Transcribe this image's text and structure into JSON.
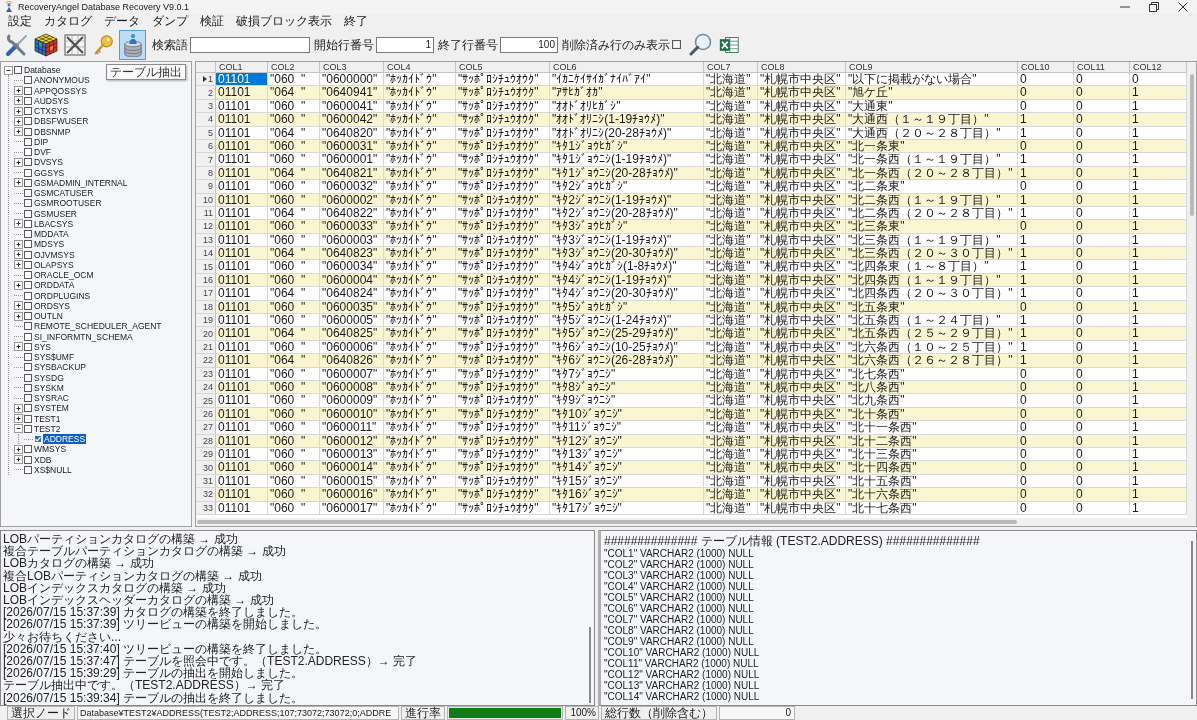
{
  "window": {
    "title": "RecoveryAngel Database Recovery V9.0.1"
  },
  "menu": [
    "設定",
    "カタログ",
    "データ",
    "ダンプ",
    "検証",
    "破損ブロック表示",
    "終了"
  ],
  "toolbar": {
    "buttons": [
      {
        "kind": "tools",
        "highlighted": false
      },
      {
        "kind": "cube",
        "highlighted": false
      },
      {
        "kind": "crossed",
        "highlighted": false
      },
      {
        "kind": "key",
        "highlighted": false
      },
      {
        "kind": "database",
        "highlighted": true,
        "tooltip": "テーブル抽出"
      }
    ],
    "search": {
      "label": "検索語"
    },
    "start_row": {
      "label": "開始行番号",
      "value": "1"
    },
    "end_row": {
      "label": "終了行番号",
      "value": "100"
    },
    "deleted_only": {
      "label": "削除済み行のみ表示",
      "checked": false
    },
    "actions": [
      {
        "kind": "search"
      },
      {
        "kind": "excel"
      }
    ]
  },
  "tree": {
    "nodes": [
      {
        "label": "Database",
        "checked": false,
        "expanded": true,
        "selected": false,
        "children": [
          {
            "label": "ANONYMOUS",
            "checked": false,
            "selected": false
          },
          {
            "label": "APPQOSSYS",
            "checked": false,
            "expanded": false,
            "selected": false
          },
          {
            "label": "AUDSYS",
            "checked": false,
            "expanded": false,
            "selected": false
          },
          {
            "label": "CTXSYS",
            "checked": false,
            "expanded": false,
            "selected": false
          },
          {
            "label": "DBSFWUSER",
            "checked": false,
            "expanded": false,
            "selected": false
          },
          {
            "label": "DBSNMP",
            "checked": false,
            "expanded": false,
            "selected": false
          },
          {
            "label": "DIP",
            "checked": false,
            "selected": false
          },
          {
            "label": "DVF",
            "checked": false,
            "selected": false
          },
          {
            "label": "DVSYS",
            "checked": false,
            "expanded": false,
            "selected": false
          },
          {
            "label": "GGSYS",
            "checked": false,
            "selected": false
          },
          {
            "label": "GSMADMIN_INTERNAL",
            "checked": false,
            "expanded": false,
            "selected": false
          },
          {
            "label": "GSMCATUSER",
            "checked": false,
            "selected": false
          },
          {
            "label": "GSMROOTUSER",
            "checked": false,
            "selected": false
          },
          {
            "label": "GSMUSER",
            "checked": false,
            "selected": false
          },
          {
            "label": "LBACSYS",
            "checked": false,
            "expanded": false,
            "selected": false
          },
          {
            "label": "MDDATA",
            "checked": false,
            "selected": false
          },
          {
            "label": "MDSYS",
            "checked": false,
            "expanded": false,
            "selected": false
          },
          {
            "label": "OJVMSYS",
            "checked": false,
            "expanded": false,
            "selected": false
          },
          {
            "label": "OLAPSYS",
            "checked": false,
            "expanded": false,
            "selected": false
          },
          {
            "label": "ORACLE_OCM",
            "checked": false,
            "selected": false
          },
          {
            "label": "ORDDATA",
            "checked": false,
            "expanded": false,
            "selected": false
          },
          {
            "label": "ORDPLUGINS",
            "checked": false,
            "selected": false
          },
          {
            "label": "ORDSYS",
            "checked": false,
            "expanded": false,
            "selected": false
          },
          {
            "label": "OUTLN",
            "checked": false,
            "expanded": false,
            "selected": false
          },
          {
            "label": "REMOTE_SCHEDULER_AGENT",
            "checked": false,
            "selected": false
          },
          {
            "label": "SI_INFORMTN_SCHEMA",
            "checked": false,
            "selected": false
          },
          {
            "label": "SYS",
            "checked": false,
            "expanded": false,
            "selected": false
          },
          {
            "label": "SYS$UMF",
            "checked": false,
            "selected": false
          },
          {
            "label": "SYSBACKUP",
            "checked": false,
            "selected": false
          },
          {
            "label": "SYSDG",
            "checked": false,
            "selected": false
          },
          {
            "label": "SYSKM",
            "checked": false,
            "selected": false
          },
          {
            "label": "SYSRAC",
            "checked": false,
            "selected": false
          },
          {
            "label": "SYSTEM",
            "checked": false,
            "expanded": false,
            "selected": false
          },
          {
            "label": "TEST1",
            "checked": false,
            "expanded": false,
            "selected": false
          },
          {
            "label": "TEST2",
            "checked": false,
            "expanded": true,
            "selected": false,
            "children": [
              {
                "label": "ADDRESS",
                "checked": true,
                "selected": true
              }
            ]
          },
          {
            "label": "WMSYS",
            "checked": false,
            "expanded": false,
            "selected": false
          },
          {
            "label": "XDB",
            "checked": false,
            "expanded": false,
            "selected": false
          },
          {
            "label": "XS$NULL",
            "checked": false,
            "selected": false
          }
        ]
      }
    ]
  },
  "table": {
    "columns": [
      "COL1",
      "COL2",
      "COL3",
      "COL4",
      "COL5",
      "COL6",
      "COL7",
      "COL8",
      "COL9",
      "COL10",
      "COL11",
      "COL12"
    ],
    "rows": [
      {
        "number": "1",
        "selected": true,
        "cells": [
          "01101",
          "\"060  \"",
          "\"0600000\"",
          "\"ﾎｯｶｲﾄﾞｳ\"",
          "\"ｻｯﾎﾟﾛｼﾁｭｳｵｳｸ\"",
          "\"ｲｶﾆｹｲｻｲｶﾞﾅｲﾊﾞｱｲ\"",
          "\"北海道\"",
          "\"札幌市中央区\"",
          "\"以下に掲載がない場合\"",
          "0",
          "0",
          "0"
        ]
      },
      {
        "number": "2",
        "selected": false,
        "cells": [
          "01101",
          "\"064  \"",
          "\"0640941\"",
          "\"ﾎｯｶｲﾄﾞｳ\"",
          "\"ｻｯﾎﾟﾛｼﾁｭｳｵｳｸ\"",
          "\"ｱｻﾋｶﾞｵｶ\"",
          "\"北海道\"",
          "\"札幌市中央区\"",
          "\"旭ケ丘\"",
          "0",
          "0",
          "1"
        ]
      },
      {
        "number": "3",
        "selected": false,
        "cells": [
          "01101",
          "\"060  \"",
          "\"0600041\"",
          "\"ﾎｯｶｲﾄﾞｳ\"",
          "\"ｻｯﾎﾟﾛｼﾁｭｳｵｳｸ\"",
          "\"ｵｵﾄﾞｵﾘﾋｶﾞｼ\"",
          "\"北海道\"",
          "\"札幌市中央区\"",
          "\"大通東\"",
          "0",
          "0",
          "1"
        ]
      },
      {
        "number": "4",
        "selected": false,
        "cells": [
          "01101",
          "\"060  \"",
          "\"0600042\"",
          "\"ﾎｯｶｲﾄﾞｳ\"",
          "\"ｻｯﾎﾟﾛｼﾁｭｳｵｳｸ\"",
          "\"ｵｵﾄﾞｵﾘﾆｼ(1-19ﾁｮｳﾒ)\"",
          "\"北海道\"",
          "\"札幌市中央区\"",
          "\"大通西（１～１９丁目）\"",
          "1",
          "0",
          "1"
        ]
      },
      {
        "number": "5",
        "selected": false,
        "cells": [
          "01101",
          "\"064  \"",
          "\"0640820\"",
          "\"ﾎｯｶｲﾄﾞｳ\"",
          "\"ｻｯﾎﾟﾛｼﾁｭｳｵｳｸ\"",
          "\"ｵｵﾄﾞｵﾘﾆｼ(20-28ﾁｮｳﾒ)\"",
          "\"北海道\"",
          "\"札幌市中央区\"",
          "\"大通西（２０～２８丁目）\"",
          "1",
          "0",
          "1"
        ]
      },
      {
        "number": "6",
        "selected": false,
        "cells": [
          "01101",
          "\"060  \"",
          "\"0600031\"",
          "\"ﾎｯｶｲﾄﾞｳ\"",
          "\"ｻｯﾎﾟﾛｼﾁｭｳｵｳｸ\"",
          "\"ｷﾀ1ｼﾞｮｳﾋｶﾞｼ\"",
          "\"北海道\"",
          "\"札幌市中央区\"",
          "\"北一条東\"",
          "0",
          "0",
          "1"
        ]
      },
      {
        "number": "7",
        "selected": false,
        "cells": [
          "01101",
          "\"060  \"",
          "\"0600001\"",
          "\"ﾎｯｶｲﾄﾞｳ\"",
          "\"ｻｯﾎﾟﾛｼﾁｭｳｵｳｸ\"",
          "\"ｷﾀ1ｼﾞｮｳﾆｼ(1-19ﾁｮｳﾒ)\"",
          "\"北海道\"",
          "\"札幌市中央区\"",
          "\"北一条西（１～１９丁目）\"",
          "1",
          "0",
          "1"
        ]
      },
      {
        "number": "8",
        "selected": false,
        "cells": [
          "01101",
          "\"064  \"",
          "\"0640821\"",
          "\"ﾎｯｶｲﾄﾞｳ\"",
          "\"ｻｯﾎﾟﾛｼﾁｭｳｵｳｸ\"",
          "\"ｷﾀ1ｼﾞｮｳﾆｼ(20-28ﾁｮｳﾒ)\"",
          "\"北海道\"",
          "\"札幌市中央区\"",
          "\"北一条西（２０～２８丁目）\"",
          "1",
          "0",
          "1"
        ]
      },
      {
        "number": "9",
        "selected": false,
        "cells": [
          "01101",
          "\"060  \"",
          "\"0600032\"",
          "\"ﾎｯｶｲﾄﾞｳ\"",
          "\"ｻｯﾎﾟﾛｼﾁｭｳｵｳｸ\"",
          "\"ｷﾀ2ｼﾞｮｳﾋｶﾞｼ\"",
          "\"北海道\"",
          "\"札幌市中央区\"",
          "\"北二条東\"",
          "0",
          "0",
          "1"
        ]
      },
      {
        "number": "10",
        "selected": false,
        "cells": [
          "01101",
          "\"060  \"",
          "\"0600002\"",
          "\"ﾎｯｶｲﾄﾞｳ\"",
          "\"ｻｯﾎﾟﾛｼﾁｭｳｵｳｸ\"",
          "\"ｷﾀ2ｼﾞｮｳﾆｼ(1-19ﾁｮｳﾒ)\"",
          "\"北海道\"",
          "\"札幌市中央区\"",
          "\"北二条西（１～１９丁目）\"",
          "1",
          "0",
          "1"
        ]
      },
      {
        "number": "11",
        "selected": false,
        "cells": [
          "01101",
          "\"064  \"",
          "\"0640822\"",
          "\"ﾎｯｶｲﾄﾞｳ\"",
          "\"ｻｯﾎﾟﾛｼﾁｭｳｵｳｸ\"",
          "\"ｷﾀ2ｼﾞｮｳﾆｼ(20-28ﾁｮｳﾒ)\"",
          "\"北海道\"",
          "\"札幌市中央区\"",
          "\"北二条西（２０～２８丁目）\"",
          "1",
          "0",
          "1"
        ]
      },
      {
        "number": "12",
        "selected": false,
        "cells": [
          "01101",
          "\"060  \"",
          "\"0600033\"",
          "\"ﾎｯｶｲﾄﾞｳ\"",
          "\"ｻｯﾎﾟﾛｼﾁｭｳｵｳｸ\"",
          "\"ｷﾀ3ｼﾞｮｳﾋｶﾞｼ\"",
          "\"北海道\"",
          "\"札幌市中央区\"",
          "\"北三条東\"",
          "0",
          "0",
          "1"
        ]
      },
      {
        "number": "13",
        "selected": false,
        "cells": [
          "01101",
          "\"060  \"",
          "\"0600003\"",
          "\"ﾎｯｶｲﾄﾞｳ\"",
          "\"ｻｯﾎﾟﾛｼﾁｭｳｵｳｸ\"",
          "\"ｷﾀ3ｼﾞｮｳﾆｼ(1-19ﾁｮｳﾒ)\"",
          "\"北海道\"",
          "\"札幌市中央区\"",
          "\"北三条西（１～１９丁目）\"",
          "1",
          "0",
          "1"
        ]
      },
      {
        "number": "14",
        "selected": false,
        "cells": [
          "01101",
          "\"064  \"",
          "\"0640823\"",
          "\"ﾎｯｶｲﾄﾞｳ\"",
          "\"ｻｯﾎﾟﾛｼﾁｭｳｵｳｸ\"",
          "\"ｷﾀ3ｼﾞｮｳﾆｼ(20-30ﾁｮｳﾒ)\"",
          "\"北海道\"",
          "\"札幌市中央区\"",
          "\"北三条西（２０～３０丁目）\"",
          "1",
          "0",
          "1"
        ]
      },
      {
        "number": "15",
        "selected": false,
        "cells": [
          "01101",
          "\"060  \"",
          "\"0600034\"",
          "\"ﾎｯｶｲﾄﾞｳ\"",
          "\"ｻｯﾎﾟﾛｼﾁｭｳｵｳｸ\"",
          "\"ｷﾀ4ｼﾞｮｳﾋｶﾞｼ(1-8ﾁｮｳﾒ)\"",
          "\"北海道\"",
          "\"札幌市中央区\"",
          "\"北四条東（１～８丁目）\"",
          "1",
          "0",
          "1"
        ]
      },
      {
        "number": "16",
        "selected": false,
        "cells": [
          "01101",
          "\"060  \"",
          "\"0600004\"",
          "\"ﾎｯｶｲﾄﾞｳ\"",
          "\"ｻｯﾎﾟﾛｼﾁｭｳｵｳｸ\"",
          "\"ｷﾀ4ｼﾞｮｳﾆｼ(1-19ﾁｮｳﾒ)\"",
          "\"北海道\"",
          "\"札幌市中央区\"",
          "\"北四条西（１～１９丁目）\"",
          "1",
          "0",
          "1"
        ]
      },
      {
        "number": "17",
        "selected": false,
        "cells": [
          "01101",
          "\"064  \"",
          "\"0640824\"",
          "\"ﾎｯｶｲﾄﾞｳ\"",
          "\"ｻｯﾎﾟﾛｼﾁｭｳｵｳｸ\"",
          "\"ｷﾀ4ｼﾞｮｳﾆｼ(20-30ﾁｮｳﾒ)\"",
          "\"北海道\"",
          "\"札幌市中央区\"",
          "\"北四条西（２０～３０丁目）\"",
          "1",
          "0",
          "1"
        ]
      },
      {
        "number": "18",
        "selected": false,
        "cells": [
          "01101",
          "\"060  \"",
          "\"0600035\"",
          "\"ﾎｯｶｲﾄﾞｳ\"",
          "\"ｻｯﾎﾟﾛｼﾁｭｳｵｳｸ\"",
          "\"ｷﾀ5ｼﾞｮｳﾋｶﾞｼ\"",
          "\"北海道\"",
          "\"札幌市中央区\"",
          "\"北五条東\"",
          "0",
          "0",
          "1"
        ]
      },
      {
        "number": "19",
        "selected": false,
        "cells": [
          "01101",
          "\"060  \"",
          "\"0600005\"",
          "\"ﾎｯｶｲﾄﾞｳ\"",
          "\"ｻｯﾎﾟﾛｼﾁｭｳｵｳｸ\"",
          "\"ｷﾀ5ｼﾞｮｳﾆｼ(1-24ﾁｮｳﾒ)\"",
          "\"北海道\"",
          "\"札幌市中央区\"",
          "\"北五条西（１～２４丁目）\"",
          "1",
          "0",
          "1"
        ]
      },
      {
        "number": "20",
        "selected": false,
        "cells": [
          "01101",
          "\"064  \"",
          "\"0640825\"",
          "\"ﾎｯｶｲﾄﾞｳ\"",
          "\"ｻｯﾎﾟﾛｼﾁｭｳｵｳｸ\"",
          "\"ｷﾀ5ｼﾞｮｳﾆｼ(25-29ﾁｮｳﾒ)\"",
          "\"北海道\"",
          "\"札幌市中央区\"",
          "\"北五条西（２５～２９丁目）\"",
          "1",
          "0",
          "1"
        ]
      },
      {
        "number": "21",
        "selected": false,
        "cells": [
          "01101",
          "\"060  \"",
          "\"0600006\"",
          "\"ﾎｯｶｲﾄﾞｳ\"",
          "\"ｻｯﾎﾟﾛｼﾁｭｳｵｳｸ\"",
          "\"ｷﾀ6ｼﾞｮｳﾆｼ(10-25ﾁｮｳﾒ)\"",
          "\"北海道\"",
          "\"札幌市中央区\"",
          "\"北六条西（１０～２５丁目）\"",
          "1",
          "0",
          "1"
        ]
      },
      {
        "number": "22",
        "selected": false,
        "cells": [
          "01101",
          "\"064  \"",
          "\"0640826\"",
          "\"ﾎｯｶｲﾄﾞｳ\"",
          "\"ｻｯﾎﾟﾛｼﾁｭｳｵｳｸ\"",
          "\"ｷﾀ6ｼﾞｮｳﾆｼ(26-28ﾁｮｳﾒ)\"",
          "\"北海道\"",
          "\"札幌市中央区\"",
          "\"北六条西（２６～２８丁目）\"",
          "1",
          "0",
          "1"
        ]
      },
      {
        "number": "23",
        "selected": false,
        "cells": [
          "01101",
          "\"060  \"",
          "\"0600007\"",
          "\"ﾎｯｶｲﾄﾞｳ\"",
          "\"ｻｯﾎﾟﾛｼﾁｭｳｵｳｸ\"",
          "\"ｷﾀ7ｼﾞｮｳﾆｼ\"",
          "\"北海道\"",
          "\"札幌市中央区\"",
          "\"北七条西\"",
          "0",
          "0",
          "1"
        ]
      },
      {
        "number": "24",
        "selected": false,
        "cells": [
          "01101",
          "\"060  \"",
          "\"0600008\"",
          "\"ﾎｯｶｲﾄﾞｳ\"",
          "\"ｻｯﾎﾟﾛｼﾁｭｳｵｳｸ\"",
          "\"ｷﾀ8ｼﾞｮｳﾆｼ\"",
          "\"北海道\"",
          "\"札幌市中央区\"",
          "\"北八条西\"",
          "0",
          "0",
          "1"
        ]
      },
      {
        "number": "25",
        "selected": false,
        "cells": [
          "01101",
          "\"060  \"",
          "\"0600009\"",
          "\"ﾎｯｶｲﾄﾞｳ\"",
          "\"ｻｯﾎﾟﾛｼﾁｭｳｵｳｸ\"",
          "\"ｷﾀ9ｼﾞｮｳﾆｼ\"",
          "\"北海道\"",
          "\"札幌市中央区\"",
          "\"北九条西\"",
          "0",
          "0",
          "1"
        ]
      },
      {
        "number": "26",
        "selected": false,
        "cells": [
          "01101",
          "\"060  \"",
          "\"0600010\"",
          "\"ﾎｯｶｲﾄﾞｳ\"",
          "\"ｻｯﾎﾟﾛｼﾁｭｳｵｳｸ\"",
          "\"ｷﾀ10ｼﾞｮｳﾆｼ\"",
          "\"北海道\"",
          "\"札幌市中央区\"",
          "\"北十条西\"",
          "0",
          "0",
          "1"
        ]
      },
      {
        "number": "27",
        "selected": false,
        "cells": [
          "01101",
          "\"060  \"",
          "\"0600011\"",
          "\"ﾎｯｶｲﾄﾞｳ\"",
          "\"ｻｯﾎﾟﾛｼﾁｭｳｵｳｸ\"",
          "\"ｷﾀ11ｼﾞｮｳﾆｼ\"",
          "\"北海道\"",
          "\"札幌市中央区\"",
          "\"北十一条西\"",
          "0",
          "0",
          "1"
        ]
      },
      {
        "number": "28",
        "selected": false,
        "cells": [
          "01101",
          "\"060  \"",
          "\"0600012\"",
          "\"ﾎｯｶｲﾄﾞｳ\"",
          "\"ｻｯﾎﾟﾛｼﾁｭｳｵｳｸ\"",
          "\"ｷﾀ12ｼﾞｮｳﾆｼ\"",
          "\"北海道\"",
          "\"札幌市中央区\"",
          "\"北十二条西\"",
          "0",
          "0",
          "1"
        ]
      },
      {
        "number": "29",
        "selected": false,
        "cells": [
          "01101",
          "\"060  \"",
          "\"0600013\"",
          "\"ﾎｯｶｲﾄﾞｳ\"",
          "\"ｻｯﾎﾟﾛｼﾁｭｳｵｳｸ\"",
          "\"ｷﾀ13ｼﾞｮｳﾆｼ\"",
          "\"北海道\"",
          "\"札幌市中央区\"",
          "\"北十三条西\"",
          "0",
          "0",
          "1"
        ]
      },
      {
        "number": "30",
        "selected": false,
        "cells": [
          "01101",
          "\"060  \"",
          "\"0600014\"",
          "\"ﾎｯｶｲﾄﾞｳ\"",
          "\"ｻｯﾎﾟﾛｼﾁｭｳｵｳｸ\"",
          "\"ｷﾀ14ｼﾞｮｳﾆｼ\"",
          "\"北海道\"",
          "\"札幌市中央区\"",
          "\"北十四条西\"",
          "0",
          "0",
          "1"
        ]
      },
      {
        "number": "31",
        "selected": false,
        "cells": [
          "01101",
          "\"060  \"",
          "\"0600015\"",
          "\"ﾎｯｶｲﾄﾞｳ\"",
          "\"ｻｯﾎﾟﾛｼﾁｭｳｵｳｸ\"",
          "\"ｷﾀ15ｼﾞｮｳﾆｼ\"",
          "\"北海道\"",
          "\"札幌市中央区\"",
          "\"北十五条西\"",
          "0",
          "0",
          "1"
        ]
      },
      {
        "number": "32",
        "selected": false,
        "cells": [
          "01101",
          "\"060  \"",
          "\"0600016\"",
          "\"ﾎｯｶｲﾄﾞｳ\"",
          "\"ｻｯﾎﾟﾛｼﾁｭｳｵｳｸ\"",
          "\"ｷﾀ16ｼﾞｮｳﾆｼ\"",
          "\"北海道\"",
          "\"札幌市中央区\"",
          "\"北十六条西\"",
          "0",
          "0",
          "1"
        ]
      },
      {
        "number": "33",
        "selected": false,
        "cells": [
          "01101",
          "\"060  \"",
          "\"0600017\"",
          "\"ﾎｯｶｲﾄﾞｳ\"",
          "\"ｻｯﾎﾟﾛｼﾁｭｳｵｳｸ\"",
          "\"ｷﾀ17ｼﾞｮｳﾆｼ\"",
          "\"北海道\"",
          "\"札幌市中央区\"",
          "\"北十七条西\"",
          "0",
          "0",
          "1"
        ]
      }
    ]
  },
  "log": [
    "LOBパーティションカタログの構築 → 成功",
    "複合テーブルパーティションカタログの構築 → 成功",
    "LOBカタログの構築 → 成功",
    "複合LOBパーティションカタログの構築 → 成功",
    "LOBインデックスカタログの構築 → 成功",
    "LOBインデックスヘッダーカタログの構築 → 成功",
    "[2026/07/15 15:37:39] カタログの構築を終了しました。",
    "[2026/07/15 15:37:39] ツリービューの構築を開始しました。",
    "少々お待ちください...",
    "[2026/07/15 15:37:40] ツリービューの構築を終了しました。",
    "[2026/07/15 15:37:47] テーブルを照会中です。（TEST2.ADDRESS）→ 完了",
    "[2026/07/15 15:39:29] テーブルの抽出を開始しました。",
    "テーブル抽出中です。（TEST2.ADDRESS）→ 完了",
    "[2026/07/15 15:39:34] テーブルの抽出を終了しました。"
  ],
  "table_info": {
    "title": "############## テーブル情報 (TEST2.ADDRESS) ##############",
    "lines": [
      "\"COL1\" VARCHAR2 (1000) NULL",
      "\"COL2\" VARCHAR2 (1000) NULL",
      "\"COL3\" VARCHAR2 (1000) NULL",
      "\"COL4\" VARCHAR2 (1000) NULL",
      "\"COL5\" VARCHAR2 (1000) NULL",
      "\"COL6\" VARCHAR2 (1000) NULL",
      "\"COL7\" VARCHAR2 (1000) NULL",
      "\"COL8\" VARCHAR2 (1000) NULL",
      "\"COL9\" VARCHAR2 (1000) NULL",
      "\"COL10\" VARCHAR2 (1000) NULL",
      "\"COL11\" VARCHAR2 (1000) NULL",
      "\"COL12\" VARCHAR2 (1000) NULL",
      "\"COL13\" VARCHAR2 (1000) NULL",
      "\"COL14\" VARCHAR2 (1000) NULL"
    ]
  },
  "status_bar": {
    "selected_node_label": "選択ノード",
    "selected_node": "Database¥TEST2¥ADDRESS(TEST2;ADDRESS;107;73072;73072;0;ADDRE",
    "progress_label": "進行率",
    "progress": {
      "level": 1,
      "reading": "100%"
    },
    "total_rows_label": "総行数（削除含む）",
    "total_rows": "0"
  }
}
